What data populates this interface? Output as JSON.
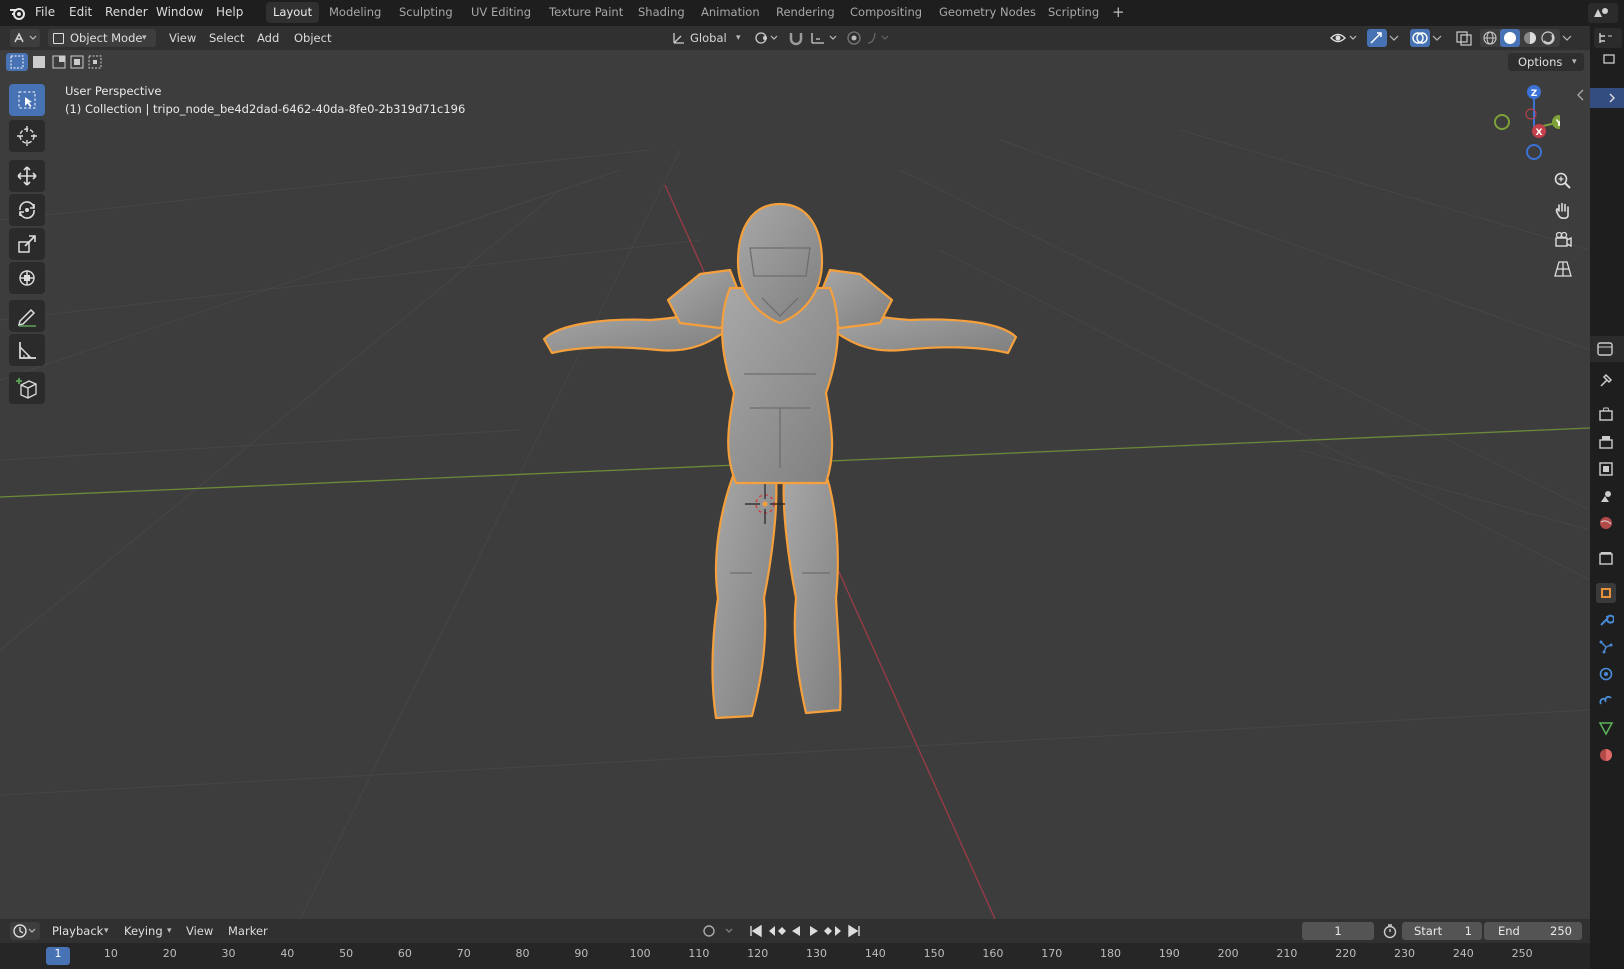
{
  "top_menu": {
    "items": [
      "File",
      "Edit",
      "Render",
      "Window",
      "Help"
    ],
    "workspaces": [
      "Layout",
      "Modeling",
      "Sculpting",
      "UV Editing",
      "Texture Paint",
      "Shading",
      "Animation",
      "Rendering",
      "Compositing",
      "Geometry Nodes",
      "Scripting"
    ],
    "active_workspace": "Layout",
    "add_tab": "+"
  },
  "header": {
    "mode": "Object Mode",
    "menus": [
      "View",
      "Select",
      "Add",
      "Object"
    ],
    "transform_orientation": "Global"
  },
  "viewport": {
    "view_name": "User Perspective",
    "collection_info": "(1) Collection | tripo_node_be4d2dad-6462-40da-8fe0-2b319d71c196",
    "options_label": "Options",
    "gizmo": {
      "z": "Z",
      "y": "Y",
      "x": "X"
    }
  },
  "timeline": {
    "menus": [
      "Playback",
      "Keying",
      "View",
      "Marker"
    ],
    "current_frame": "1",
    "start_label": "Start",
    "start_value": "1",
    "end_label": "End",
    "end_value": "250",
    "ruler": [
      "1",
      "10",
      "20",
      "30",
      "40",
      "50",
      "60",
      "70",
      "80",
      "90",
      "100",
      "110",
      "120",
      "130",
      "140",
      "150",
      "160",
      "170",
      "180",
      "190",
      "200",
      "210",
      "220",
      "230",
      "240",
      "250"
    ]
  },
  "colors": {
    "accent": "#4772b3",
    "selection_outline": "#f5a03c",
    "axis_x": "#c4404c",
    "axis_y": "#7ea13a",
    "axis_z": "#3b72d6",
    "viewport_bg": "#3d3d3d"
  }
}
